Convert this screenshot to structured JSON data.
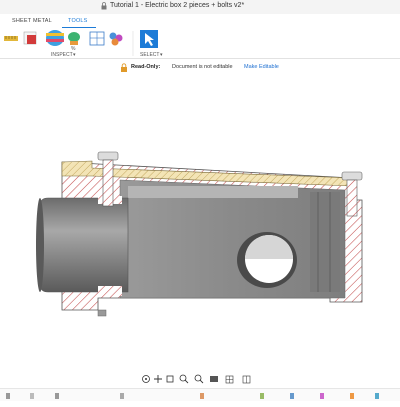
{
  "window": {
    "title": "Tutorial 1 - Electric box 2 pieces + bolts v2*"
  },
  "tabs": [
    {
      "label": "SHEET METAL",
      "active": false
    },
    {
      "label": "TOOLS",
      "active": true
    }
  ],
  "ribbon": {
    "inspect_label": "INSPECT",
    "select_label": "SELECT"
  },
  "readonly_bar": {
    "label": "Read-Only:",
    "message": "Document is not editable",
    "action": "Make Editable"
  },
  "colors": {
    "accent": "#1d7bd7",
    "hatch": "#c24a4a",
    "part_gray": "#8e8e8e",
    "lid": "#f1e3b0"
  },
  "icons": [
    "lock-icon",
    "measure-icon",
    "section-analysis-icon",
    "zebra-analysis-icon",
    "draft-analysis-icon",
    "curvature-icon",
    "display-component-icon",
    "appearance-icon",
    "select-icon",
    "orbit-icon",
    "pan-icon",
    "look-at-icon",
    "zoom-icon",
    "fit-icon",
    "display-settings-icon",
    "grid-icon",
    "viewports-icon"
  ]
}
